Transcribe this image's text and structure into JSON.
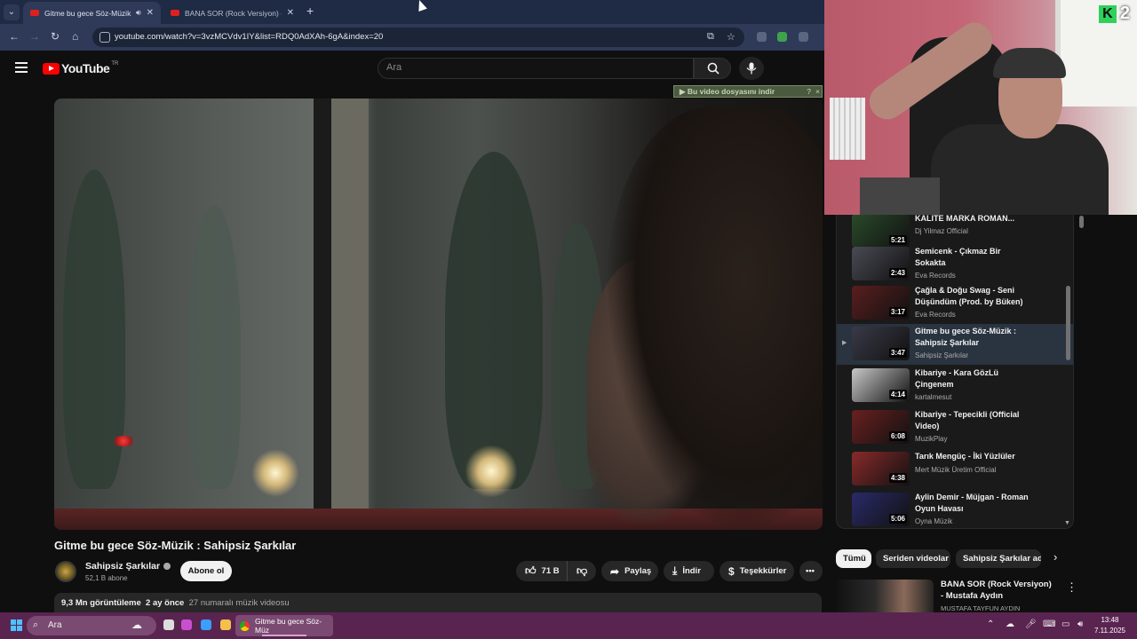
{
  "browser": {
    "tabs": [
      {
        "title": "Gitme bu gece Söz-Müzik : Sahipsiz Şarkılar",
        "audible": true,
        "active": true
      },
      {
        "title": "BANA SOR (Rock Versiyon) - Mustafa Aydın",
        "audible": false,
        "active": false
      }
    ],
    "new_tab_icon": "plus-icon",
    "url": "youtube.com/watch?v=3vzMCVdv1IY&list=RDQ0AdXAh-6gA&index=20"
  },
  "youtube": {
    "logo_text": "YouTube",
    "region": "TR",
    "search_placeholder": "Ara"
  },
  "download_banner": {
    "label": "Bu video dosyasını indir",
    "help": "?",
    "close": "×"
  },
  "video": {
    "title": "Gitme bu gece Söz-Müzik : Sahipsiz Şarkılar",
    "channel": "Sahipsiz Şarkılar",
    "subscribers": "52,1 B abone",
    "subscribe_label": "Abone ol",
    "likes": "71 B",
    "share_label": "Paylaş",
    "download_label": "İndir",
    "thanks_label": "Teşekkürler",
    "views": "9,3 Mn görüntüleme",
    "age": "2 ay önce",
    "tag": "27 numaralı müzik videosu"
  },
  "playlist": [
    {
      "title": "KALİTE MARKA ROMAN...",
      "channel": "Dj Yilmaz Official",
      "duration": "5:21",
      "current": false,
      "thumb": "#2a4a2a"
    },
    {
      "title": "Semicenk - Çıkmaz Bir Sokakta",
      "channel": "Eva Records",
      "duration": "2:43",
      "current": false,
      "thumb": "#4a4a55"
    },
    {
      "title": "Çağla & Doğu Swag - Seni Düşündüm (Prod. by Büken)",
      "channel": "Eva Records",
      "duration": "3:17",
      "current": false,
      "thumb": "#5a1e1e"
    },
    {
      "title": "Gitme bu gece Söz-Müzik : Sahipsiz Şarkılar",
      "channel": "Sahipsiz Şarkılar",
      "duration": "3:47",
      "current": true,
      "thumb": "#3a3a48"
    },
    {
      "title": "Kibariye - Kara GözLü Çingenem",
      "channel": "kartalmesut",
      "duration": "4:14",
      "current": false,
      "thumb": "#c8c8c8"
    },
    {
      "title": "Kibariye - Tepecikli (Official Video)",
      "channel": "MuzikPlay",
      "duration": "6:08",
      "current": false,
      "thumb": "#6a2020"
    },
    {
      "title": "Tarık Mengüç - İki Yüzlüler",
      "channel": "Mert Müzik Üretim Official",
      "duration": "4:38",
      "current": false,
      "thumb": "#8a2a2a"
    },
    {
      "title": "Aylin Demir - Müjgan - Roman Oyun Havası",
      "channel": "Oyna Müzik",
      "duration": "5:06",
      "current": false,
      "thumb": "#2a2a6a"
    }
  ],
  "chips": [
    "Tümü",
    "Seriden videolar",
    "Sahipsiz Şarkılar adlı"
  ],
  "recommended": {
    "title": "BANA SOR (Rock Versiyon) - Mustafa Aydın",
    "channel": "MUSTAFA TAYFUN AYDIN"
  },
  "webcam": {
    "badge_letter": "K",
    "badge_number": "2"
  },
  "taskbar": {
    "search_label": "Ara",
    "active_app": "Gitme bu gece Söz-Müz",
    "time": "13:48",
    "date": "7.11.2025"
  },
  "colors": {
    "background": "#0f0f0f",
    "youtube_red": "#ff0000",
    "taskbar": "#5a2450",
    "browser_frame": "#2e3a58",
    "current_item": "#2a3340"
  }
}
